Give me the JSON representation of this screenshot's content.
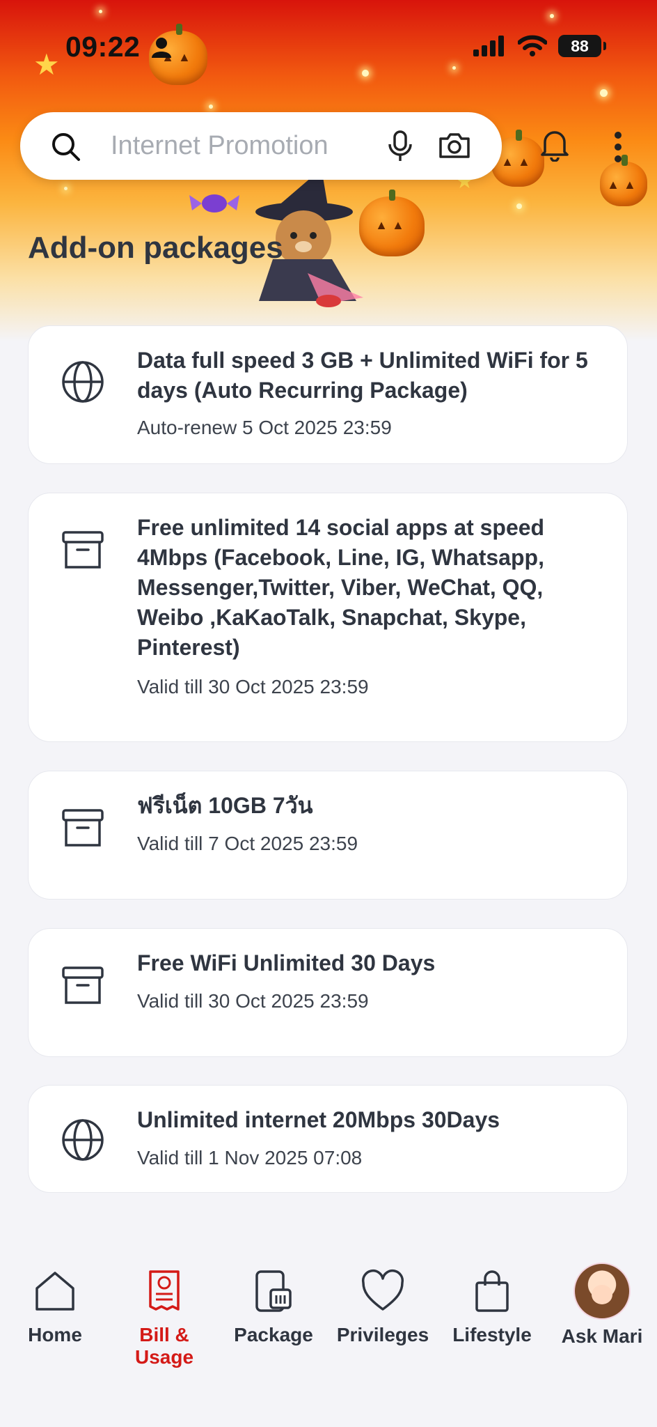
{
  "status_bar": {
    "time": "09:22",
    "battery": "88"
  },
  "search": {
    "placeholder": "Internet Promotion"
  },
  "page": {
    "title": "Add-on packages"
  },
  "packages": [
    {
      "icon": "globe-icon",
      "title": "Data full speed 3 GB + Unlimited WiFi for 5 days (Auto Recurring Package)",
      "subtitle": "Auto-renew 5 Oct 2025 23:59"
    },
    {
      "icon": "archive-box-icon",
      "title": "Free unlimited 14 social apps at speed 4Mbps (Facebook, Line, IG, Whatsapp, Messenger,Twitter, Viber, WeChat, QQ, Weibo ,KaKaoTalk, Snapchat, Skype, Pinterest)",
      "subtitle": "Valid till 30 Oct 2025 23:59"
    },
    {
      "icon": "archive-box-icon",
      "title": "ฟรีเน็ต 10GB 7วัน",
      "subtitle": "Valid till 7 Oct 2025 23:59"
    },
    {
      "icon": "archive-box-icon",
      "title": "Free WiFi Unlimited 30 Days",
      "subtitle": "Valid till 30 Oct 2025 23:59"
    },
    {
      "icon": "globe-icon",
      "title": "Unlimited internet 20Mbps 30Days",
      "subtitle": "Valid till 1 Nov 2025 07:08"
    }
  ],
  "nav": [
    {
      "label": "Home",
      "icon": "home-icon",
      "active": false
    },
    {
      "label": "Bill & Usage",
      "icon": "bill-icon",
      "active": true
    },
    {
      "label": "Package",
      "icon": "sim-phone-icon",
      "active": false
    },
    {
      "label": "Privileges",
      "icon": "heart-icon",
      "active": false
    },
    {
      "label": "Lifestyle",
      "icon": "shopping-bag-icon",
      "active": false
    },
    {
      "label": "Ask Mari",
      "icon": "assistant-avatar",
      "active": false
    }
  ],
  "colors": {
    "accent": "#d41a17",
    "header_top": "#d8140c",
    "header_mid": "#fb8a14",
    "background": "#f4f4f8"
  }
}
